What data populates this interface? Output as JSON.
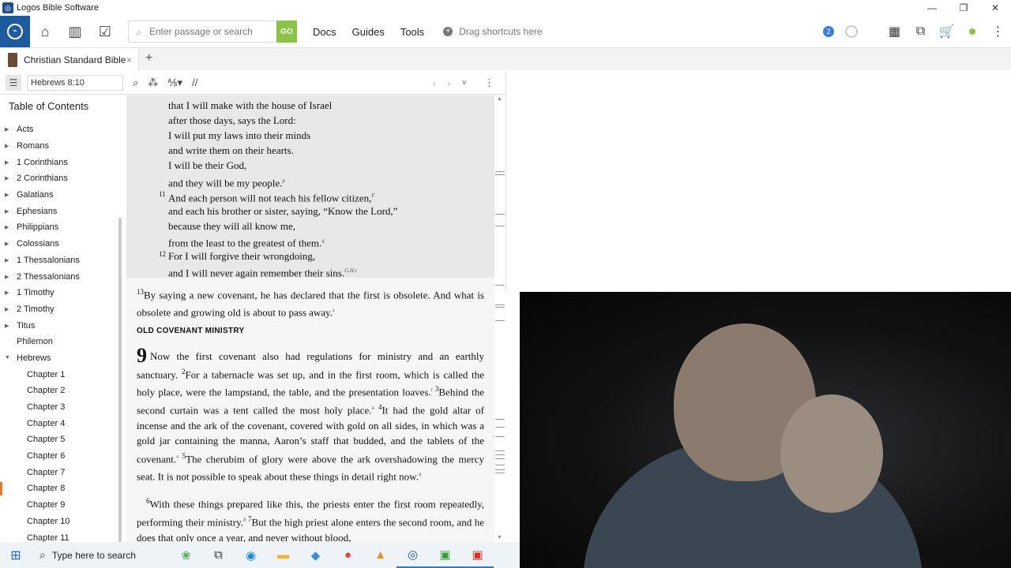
{
  "window": {
    "title": "Logos Bible Software",
    "minimize": "—",
    "maximize": "❐",
    "close": "✕"
  },
  "toolbar": {
    "search_placeholder": "Enter passage or search",
    "go_label": "GO",
    "menu": [
      "Docs",
      "Guides",
      "Tools"
    ],
    "shortcuts_label": "Drag shortcuts here",
    "notification_count": "2"
  },
  "tab": {
    "label": "Christian Standard Bible",
    "close": "×",
    "add": "+"
  },
  "panel": {
    "reference": "Hebrews 8:10",
    "parallel_label": "//"
  },
  "toc": {
    "title": "Table of Contents",
    "books": [
      "Acts",
      "Romans",
      "1 Corinthians",
      "2 Corinthians",
      "Galatians",
      "Ephesians",
      "Philippians",
      "Colossians",
      "1 Thessalonians",
      "2 Thessalonians",
      "1 Timothy",
      "2 Timothy",
      "Titus",
      "Philemon",
      "Hebrews"
    ],
    "chapters": [
      "Chapter 1",
      "Chapter 2",
      "Chapter 3",
      "Chapter 4",
      "Chapter 5",
      "Chapter 6",
      "Chapter 7",
      "Chapter 8",
      "Chapter 9",
      "Chapter 10",
      "Chapter 11"
    ],
    "selected_chapter": "Chapter 8"
  },
  "reader": {
    "poem_lines": [
      {
        "vn": "",
        "text": "that I will make with the house of Israel",
        "fn": ""
      },
      {
        "vn": "",
        "text": "after those days, says the Lord:",
        "fn": ""
      },
      {
        "vn": "",
        "text": "I will put my laws into their minds",
        "fn": ""
      },
      {
        "vn": "",
        "text": "and write them on their hearts.",
        "fn": ""
      },
      {
        "vn": "",
        "text": "I will be their God,",
        "fn": ""
      },
      {
        "vn": "",
        "text": "and they will be my people.",
        "fn": "p"
      },
      {
        "vn": "11",
        "text": "And each person will not teach his fellow citizen,",
        "fn": "F"
      },
      {
        "vn": "",
        "text": "and each his brother or sister, saying, “Know the Lord,”",
        "fn": ""
      },
      {
        "vn": "",
        "text": "because they will all know me,",
        "fn": ""
      },
      {
        "vn": "",
        "text": "from the least to the greatest of them.",
        "fn": "q"
      },
      {
        "vn": "12",
        "text": "For I will forgive their wrongdoing,",
        "fn": ""
      },
      {
        "vn": "",
        "text": "and I will never again remember their sins.",
        "fn": "G,H,r"
      }
    ],
    "v13_num": "13",
    "v13_text": "By saying a new covenant, he has declared that the first is obsolete. And what is obsolete and growing old is about to pass away.",
    "v13_fn": "s",
    "heading": "OLD COVENANT MINISTRY",
    "chapter_number": "9",
    "ch9_p1": [
      {
        "t": "Now the first covenant also had regulations for ministry and an earthly sanctuary. "
      },
      {
        "sup": "2"
      },
      {
        "t": "For a tabernacle was set up, and in the first room, which is called the holy place, were the lampstand, the table, and the presentation loaves."
      },
      {
        "fn": "t"
      },
      {
        "sup": " 3"
      },
      {
        "t": "Behind the second curtain was a tent called the most holy place."
      },
      {
        "fn": "u"
      },
      {
        "sup": " 4"
      },
      {
        "t": "It had the gold altar of incense and the ark of the covenant, covered with gold on all sides, in which was a gold jar containing the manna, Aaron’s staff that budded, and the tablets of the covenant."
      },
      {
        "fn": "v"
      },
      {
        "sup": " 5"
      },
      {
        "t": "The cherubim of glory were above the ark overshadowing the mercy seat. It is not possible to speak about these things in detail right now."
      },
      {
        "fn": "a"
      }
    ],
    "ch9_p2": [
      {
        "sup": "6"
      },
      {
        "t": "With these things prepared like this, the priests enter the first room repeatedly, performing their ministry."
      },
      {
        "fn": "b"
      },
      {
        "sup": " 7"
      },
      {
        "t": "But the high priest alone enters the second room, and he does that only once a year, and never without blood,"
      }
    ]
  },
  "taskbar": {
    "search_label": "Type here to search"
  }
}
